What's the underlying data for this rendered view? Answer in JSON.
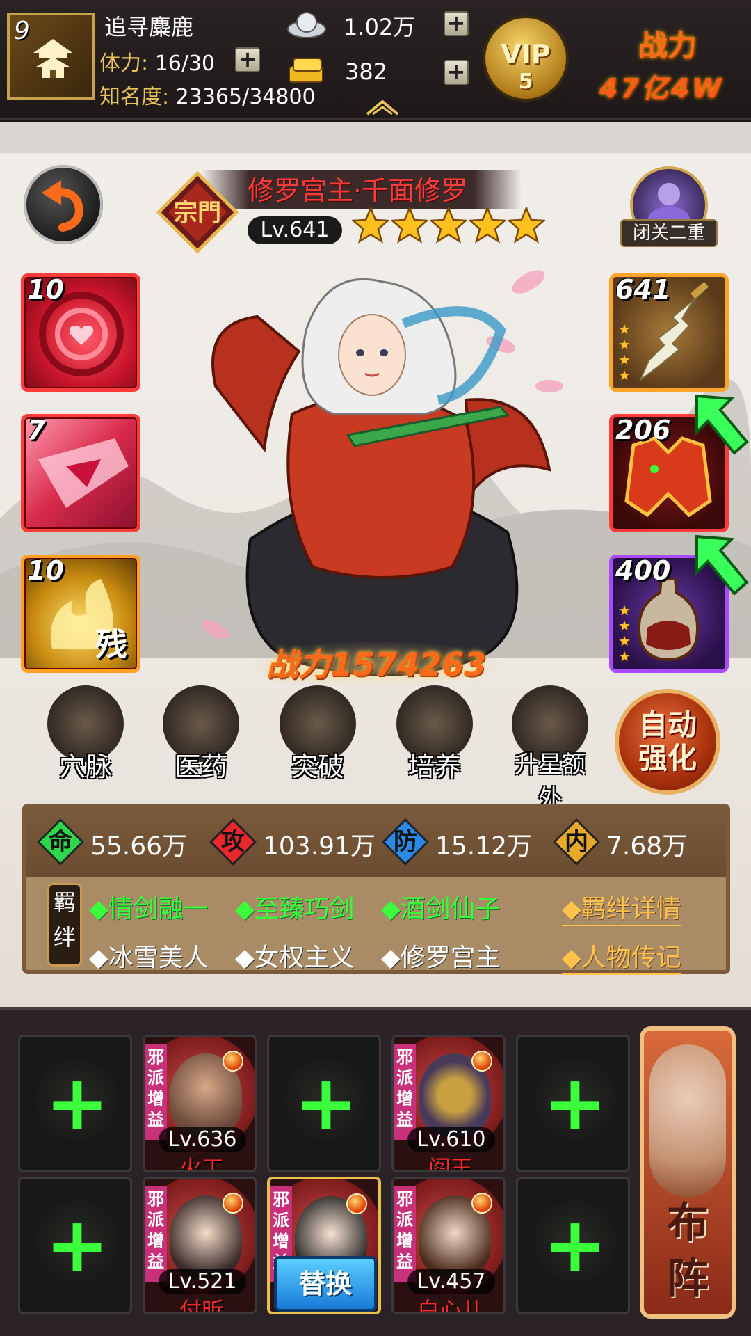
{
  "player": {
    "level": "9",
    "name": "追寻麋鹿",
    "stamina_label": "体力:",
    "stamina_value": "16/30",
    "fame_label": "知名度:",
    "fame_value": "23365/34800"
  },
  "currency": {
    "silver": "1.02万",
    "gold": "382"
  },
  "vip": {
    "label": "VIP",
    "level": "5"
  },
  "top_power": {
    "label": "战力",
    "value": "47亿4W"
  },
  "hero": {
    "name": "修罗宫主·千面修罗",
    "rank": "宗門",
    "level": "Lv.641",
    "stars": 5,
    "retreat_label": "闭关二重",
    "power_label": "战力",
    "power_value": "1574263"
  },
  "skills": [
    {
      "num": "10",
      "icon": "heart-swirl-icon"
    },
    {
      "num": "7",
      "icon": "crystal-blade-icon"
    },
    {
      "num": "10",
      "icon": "golden-flame-fragment-icon",
      "tag": "残"
    }
  ],
  "equipment": [
    {
      "num": "641",
      "icon": "sword-icon",
      "stars": 4
    },
    {
      "num": "206",
      "icon": "armor-icon",
      "stars": 0
    },
    {
      "num": "400",
      "icon": "wine-jug-icon",
      "stars": 4
    }
  ],
  "functions": [
    {
      "label": "穴脉",
      "icon": "meridian-icon"
    },
    {
      "label": "医药",
      "icon": "medicine-icon"
    },
    {
      "label": "突破",
      "icon": "breakthrough-icon"
    },
    {
      "label": "培养",
      "icon": "cultivate-icon"
    },
    {
      "label": "升星额外",
      "icon": "star-up-icon"
    }
  ],
  "auto_enhance": {
    "line1": "自动",
    "line2": "强化"
  },
  "stats": [
    {
      "gem": "命",
      "value": "55.66万",
      "color": "#2ad84a"
    },
    {
      "gem": "攻",
      "value": "103.91万",
      "color": "#e8282a"
    },
    {
      "gem": "防",
      "value": "15.12万",
      "color": "#2a8ae8"
    },
    {
      "gem": "内",
      "value": "7.68万",
      "color": "#e8a82a"
    }
  ],
  "bonds": {
    "tag": "羁绊",
    "active": [
      "◆情剑融一",
      "◆至臻巧剑",
      "◆酒剑仙子"
    ],
    "inactive": [
      "◆冰雪美人",
      "◆女权主义",
      "◆修罗宫主"
    ],
    "detail_link": "◆羁绊详情",
    "bio_link": "◆人物传记"
  },
  "formation": {
    "ribbon": "邪派增益",
    "heroes": [
      {
        "level": "Lv.636",
        "name": "火工"
      },
      {
        "level": "Lv.610",
        "name": "阎王"
      },
      {
        "level": "Lv.521",
        "name": "付昕"
      },
      {
        "level": "Lv.457",
        "name": "白心儿"
      }
    ],
    "replace_label": "替换",
    "lineup_line1": "布",
    "lineup_line2": "阵"
  }
}
